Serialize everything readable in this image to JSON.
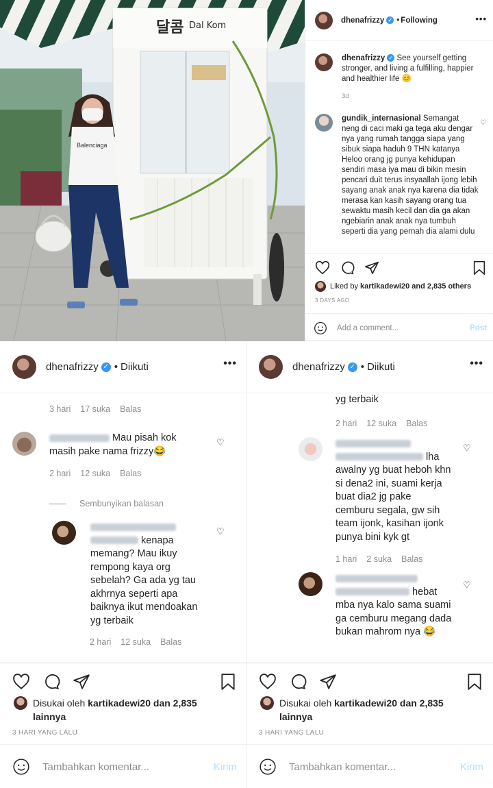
{
  "top": {
    "photo": {
      "sign_text": "Dal Kom"
    },
    "header": {
      "username": "dhenafrizzy",
      "separator": "•",
      "follow_status": "Following",
      "more": "•••"
    },
    "caption": {
      "username": "dhenafrizzy",
      "text": "See yourself getting stronger, and living a fulfilling, happier and healthier life 😊",
      "time": "3d"
    },
    "comment": {
      "username": "gundik_internasional",
      "text": "Semangat neng di caci maki ga tega aku dengar nya yang rumah tangga siapa yang sibuk siapa haduh 9 THN katanya Heloo orang jg punya kehidupan sendiri masa iya mau di bikin mesin pencari duit terus insyaallah ijong lebih sayang anak anak nya karena dia tidak merasa kan kasih sayang orang tua sewaktu masih kecil dan dia ga akan ngebiarin anak anak nya tumbuh seperti dia yang pernah dia alami dulu"
    },
    "liked": {
      "prefix": "Liked by",
      "user": "kartikadewi20",
      "suffix": "and 2,835 others"
    },
    "time": "3 DAYS AGO",
    "add_comment": {
      "placeholder": "Add a comment...",
      "post": "Post"
    }
  },
  "left": {
    "header": {
      "username": "dhenafrizzy",
      "separator": "•",
      "follow_status": "Diikuti",
      "more": "•••"
    },
    "meta1": {
      "time": "3 hari",
      "likes": "17 suka",
      "reply": "Balas"
    },
    "comment1": {
      "text": "Mau pisah kok masih pake nama frizzy😂"
    },
    "meta2": {
      "time": "2 hari",
      "likes": "12 suka",
      "reply": "Balas"
    },
    "hide_replies": "Sembunyikan balasan",
    "reply1": {
      "text": "kenapa memang? Mau ikuy rempong kaya org sebelah? Ga ada yg tau akhrnya seperti apa baiknya ikut mendoakan yg terbaik"
    },
    "meta3": {
      "time": "2 hari",
      "likes": "12 suka",
      "reply": "Balas"
    },
    "liked": {
      "prefix": "Disukai oleh",
      "user": "kartikadewi20",
      "suffix": "dan 2,835 lainnya"
    },
    "time": "3 HARI YANG LALU",
    "add_comment": {
      "placeholder": "Tambahkan komentar...",
      "post": "Kirim"
    }
  },
  "right": {
    "header": {
      "username": "dhenafrizzy",
      "separator": "•",
      "follow_status": "Diikuti",
      "more": "•••"
    },
    "tail_text": "yg terbaik",
    "meta1": {
      "time": "2 hari",
      "likes": "12 suka",
      "reply": "Balas"
    },
    "comment1": {
      "text": "lha awalny yg buat heboh khn si dena2 ini, suami kerja buat dia2 jg pake cemburu segala, gw sih team ijonk, kasihan ijonk punya bini kyk gt"
    },
    "meta2": {
      "time": "1 hari",
      "likes": "2 suka",
      "reply": "Balas"
    },
    "comment2": {
      "text": "hebat mba nya kalo sama suami ga cemburu megang dada bukan mahrom nya 😂"
    },
    "liked": {
      "prefix": "Disukai oleh",
      "user": "kartikadewi20",
      "suffix": "dan 2,835 lainnya"
    },
    "time": "3 HARI YANG LALU",
    "add_comment": {
      "placeholder": "Tambahkan komentar...",
      "post": "Kirim"
    }
  },
  "colors": {
    "verified": "#3897f0",
    "muted": "#8e8e8e",
    "post_disabled": "#b2dffc",
    "text": "#262626"
  }
}
